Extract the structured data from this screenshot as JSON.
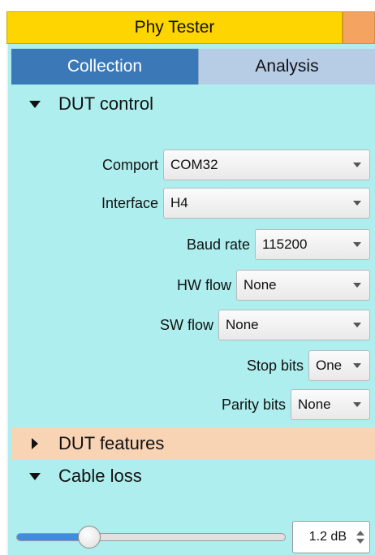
{
  "window": {
    "title": "Phy Tester"
  },
  "tabs": [
    {
      "label": "Collection",
      "active": true
    },
    {
      "label": "Analysis",
      "active": false
    }
  ],
  "sections": {
    "dut_control": {
      "title": "DUT control",
      "expanded": true
    },
    "dut_features": {
      "title": "DUT features",
      "expanded": false
    },
    "cable_loss": {
      "title": "Cable loss",
      "expanded": true
    }
  },
  "dut_control": {
    "comport": {
      "label": "Comport",
      "value": "COM32"
    },
    "interface": {
      "label": "Interface",
      "value": "H4"
    },
    "baud_rate": {
      "label": "Baud rate",
      "value": "115200"
    },
    "hw_flow": {
      "label": "HW flow",
      "value": "None"
    },
    "sw_flow": {
      "label": "SW flow",
      "value": "None"
    },
    "stop_bits": {
      "label": "Stop bits",
      "value": "One"
    },
    "parity_bits": {
      "label": "Parity bits",
      "value": "None"
    }
  },
  "cable_loss": {
    "value_text": "1.2 dB",
    "slider_fraction": 0.27
  },
  "colors": {
    "title_bg": "#ffd500",
    "active_tab": "#3a78b8",
    "panel_bg": "#aeeeee",
    "collapsed_section_bg": "#f9d4b4",
    "slider_fill": "#3d8edb"
  }
}
